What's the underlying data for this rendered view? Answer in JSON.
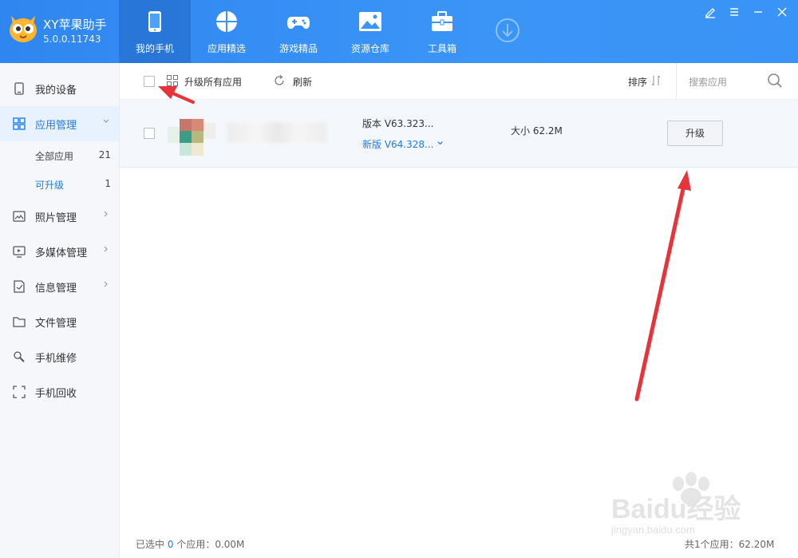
{
  "app": {
    "name": "XY苹果助手",
    "version": "5.0.0.11743"
  },
  "nav": {
    "tabs": [
      {
        "label": "我的手机",
        "icon": "phone-icon"
      },
      {
        "label": "应用精选",
        "icon": "apps-icon"
      },
      {
        "label": "游戏精品",
        "icon": "gamepad-icon"
      },
      {
        "label": "资源仓库",
        "icon": "image-icon"
      },
      {
        "label": "工具箱",
        "icon": "toolbox-icon"
      }
    ],
    "active": "我的手机"
  },
  "sidebar": {
    "items": [
      {
        "label": "我的设备",
        "icon": "device-icon"
      },
      {
        "label": "应用管理",
        "icon": "grid-icon"
      },
      {
        "label": "照片管理",
        "icon": "photo-icon"
      },
      {
        "label": "多媒体管理",
        "icon": "monitor-icon"
      },
      {
        "label": "信息管理",
        "icon": "message-icon"
      },
      {
        "label": "文件管理",
        "icon": "folder-icon"
      },
      {
        "label": "手机维修",
        "icon": "wrench-icon"
      },
      {
        "label": "手机回收",
        "icon": "recycle-icon"
      }
    ],
    "sub": [
      {
        "label": "全部应用",
        "count": "21"
      },
      {
        "label": "可升级",
        "count": "1"
      }
    ]
  },
  "toolbar": {
    "upgrade_all": "升级所有应用",
    "refresh": "刷新",
    "sort": "排序",
    "search_placeholder": "搜索应用"
  },
  "app_row": {
    "version": "版本 V63.323...",
    "new_version": "新版 V64.328...",
    "size": "大小 62.2M",
    "upgrade": "升级"
  },
  "footer": {
    "selected_prefix": "已选中",
    "selected_count": "0",
    "selected_suffix": "个应用：0.00M",
    "total": "共1个应用：62.20M"
  },
  "watermark": {
    "brand": "Baidu经验",
    "url": "jingyan.baidu.com"
  },
  "colors": {
    "header": "#2f86f0",
    "accent": "#1f7ce6",
    "annotation": "#e8333a"
  }
}
